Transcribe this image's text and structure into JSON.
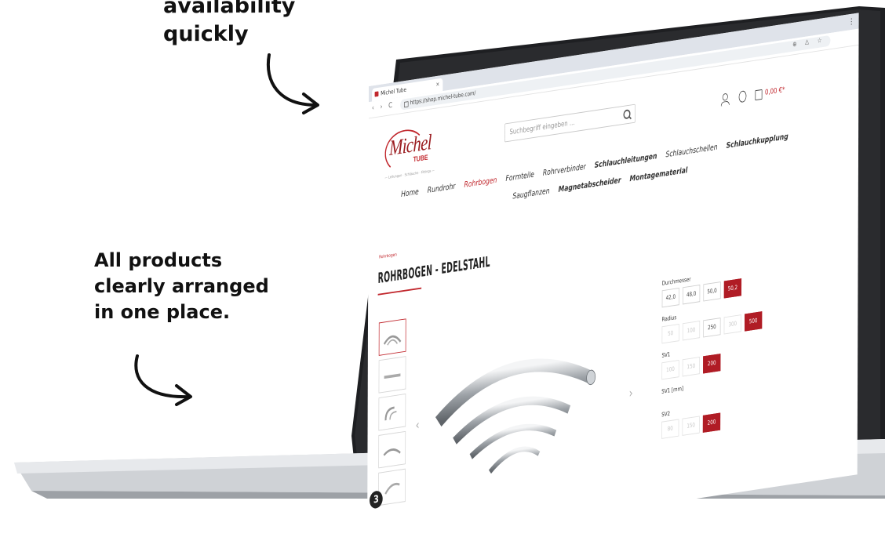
{
  "annotations": {
    "top_lines": [
      "availability",
      "quickly"
    ],
    "left_lines": [
      "All products",
      "clearly arranged",
      "in one place."
    ]
  },
  "browser": {
    "tab_title": "Michel Tube",
    "tab_close": "×",
    "more_menu": "⋮",
    "nav_buttons": "‹ › C",
    "url": "https://shop.michel-tube.com/",
    "address_icons": "⊕ ⚠ ☆"
  },
  "site": {
    "logo_text": "Michel",
    "logo_sub": "TUBE",
    "tagline": "— Leitungen · Schläuche · Fittings —",
    "search_placeholder": "Suchbegriff eingeben ...",
    "cart_total": "0,00 €*",
    "nav_row1": [
      {
        "label": "Home",
        "bold": false,
        "active": false
      },
      {
        "label": "Rundrohr",
        "bold": false,
        "active": false
      },
      {
        "label": "Rohrbogen",
        "bold": false,
        "active": true
      },
      {
        "label": "Formteile",
        "bold": false,
        "active": false
      },
      {
        "label": "Rohrverbinder",
        "bold": false,
        "active": false
      },
      {
        "label": "Schlauchleitungen",
        "bold": true,
        "active": false
      },
      {
        "label": "Schlauchschellen",
        "bold": false,
        "active": false
      },
      {
        "label": "Schlauchkupplung",
        "bold": true,
        "active": false
      }
    ],
    "nav_row2": [
      {
        "label": "Saugflanzen",
        "bold": false,
        "active": false
      },
      {
        "label": "Magnetabscheider",
        "bold": true,
        "active": false
      },
      {
        "label": "Montagematerial",
        "bold": true,
        "active": false
      }
    ],
    "breadcrumb": "Rohrbogen",
    "page_title": "ROHRBOGEN - EDELSTAHL",
    "gallery_badge": "3",
    "prev_arrow": "‹",
    "next_arrow": "›"
  },
  "variants": [
    {
      "label": "Durchmesser",
      "options": [
        {
          "text": "42,0",
          "state": "normal"
        },
        {
          "text": "48,0",
          "state": "normal"
        },
        {
          "text": "50,0",
          "state": "normal"
        },
        {
          "text": "50,2",
          "state": "selected"
        }
      ]
    },
    {
      "label": "Radius",
      "options": [
        {
          "text": "50",
          "state": "disabled"
        },
        {
          "text": "100",
          "state": "disabled"
        },
        {
          "text": "250",
          "state": "normal"
        },
        {
          "text": "300",
          "state": "disabled"
        },
        {
          "text": "500",
          "state": "selected"
        }
      ]
    },
    {
      "label": "SV1",
      "options": [
        {
          "text": "100",
          "state": "disabled"
        },
        {
          "text": "150",
          "state": "disabled"
        },
        {
          "text": "200",
          "state": "selected"
        }
      ]
    },
    {
      "label": "SV1 [mm]",
      "options": []
    },
    {
      "label": "SV2",
      "options": [
        {
          "text": "80",
          "state": "disabled"
        },
        {
          "text": "150",
          "state": "disabled"
        },
        {
          "text": "200",
          "state": "selected"
        }
      ]
    }
  ],
  "colors": {
    "brand_red": "#c1272d",
    "selected_option": "#b01c25"
  }
}
